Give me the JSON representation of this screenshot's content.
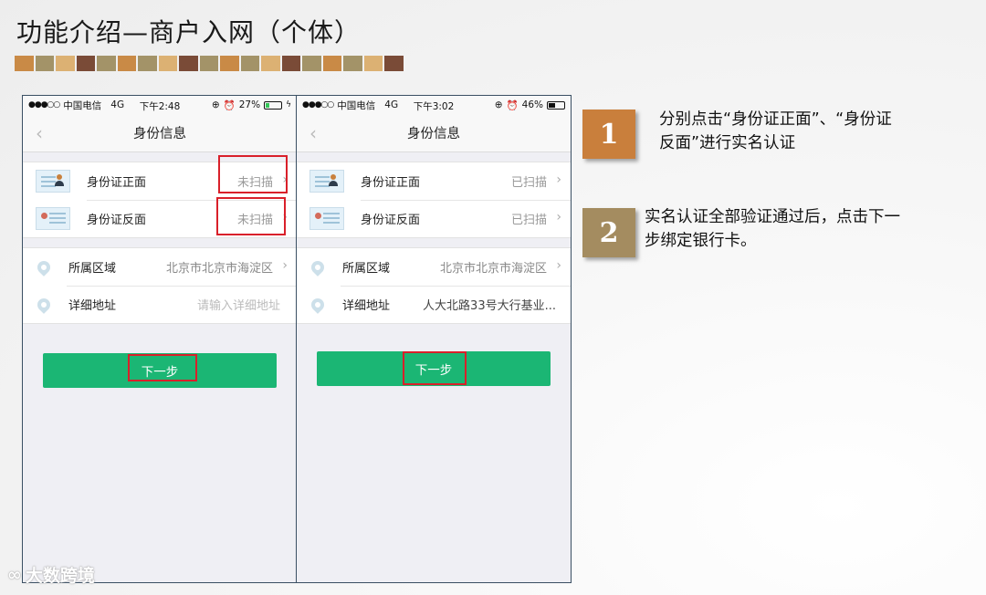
{
  "slide": {
    "title": "功能介绍—商户入网（个体）",
    "deco_colors": [
      "#c98a46",
      "#a39368",
      "#dcb173",
      "#7a4b37",
      "#a39368",
      "#c98a46",
      "#a39368",
      "#dcb173",
      "#7a4b37",
      "#a39368",
      "#c98a46",
      "#a39368",
      "#dcb173",
      "#7a4b37",
      "#a39368",
      "#c98a46",
      "#a39368",
      "#dcb173",
      "#7a4b37"
    ]
  },
  "phone1": {
    "status": {
      "carrier": "中国电信",
      "network": "4G",
      "time": "下午2:48",
      "battery": "27%",
      "battery_level": 0.27
    },
    "nav_title": "身份信息",
    "id_front_label": "身份证正面",
    "id_front_value": "未扫描",
    "id_back_label": "身份证反面",
    "id_back_value": "未扫描",
    "region_label": "所属区域",
    "region_value": "北京市北京市海淀区",
    "address_label": "详细地址",
    "address_placeholder": "请输入详细地址",
    "next_label": "下一步"
  },
  "phone2": {
    "status": {
      "carrier": "中国电信",
      "network": "4G",
      "time": "下午3:02",
      "battery": "46%",
      "battery_level": 0.46
    },
    "nav_title": "身份信息",
    "id_front_label": "身份证正面",
    "id_front_value": "已扫描",
    "id_back_label": "身份证反面",
    "id_back_value": "已扫描",
    "region_label": "所属区域",
    "region_value": "北京市北京市海淀区",
    "address_label": "详细地址",
    "address_value": "人大北路33号大行基业...",
    "next_label": "下一步"
  },
  "steps": [
    {
      "number": "1",
      "color": "#c97f3c",
      "text_line1": "分别点击“身份证正面”、“身份证",
      "text_line2": "反面”进行实名认证"
    },
    {
      "number": "2",
      "color": "#a48c60",
      "text_line1": "实名认证全部验证通过后，点击下一",
      "text_line2": "步绑定银行卡。"
    }
  ],
  "watermark": "大数跨境",
  "colors": {
    "primary_button": "#1bb674",
    "highlight": "#d9202a",
    "battery_green": "#35c759"
  }
}
